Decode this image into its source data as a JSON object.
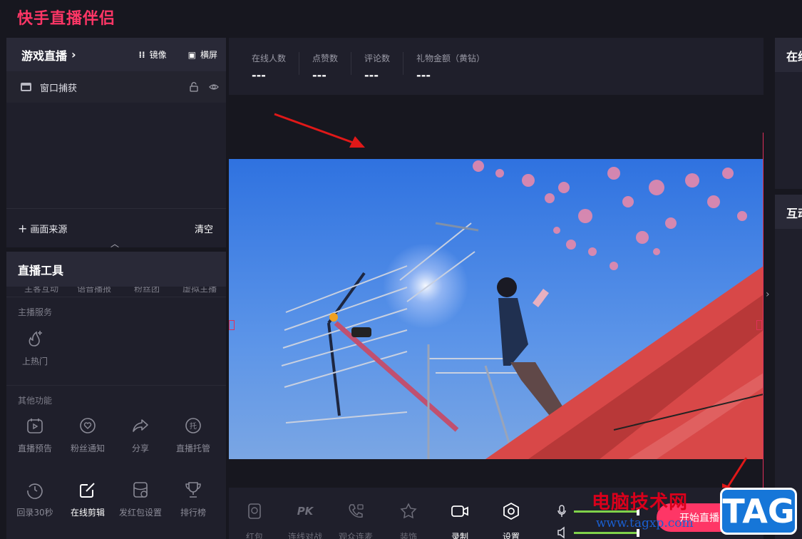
{
  "app": {
    "title": "快手直播伴侣"
  },
  "sources": {
    "title": "游戏直播",
    "mirror_label": "镜像",
    "landscape_label": "横屏",
    "items": [
      {
        "label": "窗口捕获"
      }
    ],
    "add_label": "画面来源",
    "clear_label": "清空"
  },
  "tools": {
    "title": "直播工具",
    "partial_row": [
      "主客互动",
      "语音播报",
      "粉丝团",
      "虚拟主播"
    ],
    "section_host": "主播服务",
    "host_items": [
      {
        "label": "上热门",
        "icon": "fire-plus-icon"
      }
    ],
    "section_other": "其他功能",
    "other_items": [
      {
        "label": "直播预告",
        "icon": "calendar-play-icon"
      },
      {
        "label": "粉丝通知",
        "icon": "heart-bubble-icon"
      },
      {
        "label": "分享",
        "icon": "share-arrow-icon"
      },
      {
        "label": "直播托管",
        "icon": "managed-icon"
      }
    ],
    "more_items": [
      {
        "label": "回录30秒",
        "icon": "replay-icon"
      },
      {
        "label": "在线剪辑",
        "icon": "edit-icon"
      },
      {
        "label": "发红包设置",
        "icon": "redpacket-settings-icon"
      },
      {
        "label": "排行榜",
        "icon": "trophy-icon"
      }
    ]
  },
  "stats": [
    {
      "label": "在线人数",
      "value": "---"
    },
    {
      "label": "点赞数",
      "value": "---"
    },
    {
      "label": "评论数",
      "value": "---"
    },
    {
      "label": "礼物金额（黄钻）",
      "value": "---"
    }
  ],
  "bottom_bar": {
    "items": [
      {
        "label": "红包",
        "icon": "redpacket-icon"
      },
      {
        "label": "连线对战",
        "icon": "pk-icon"
      },
      {
        "label": "观众连麦",
        "icon": "phone-call-icon"
      },
      {
        "label": "装饰",
        "icon": "decorate-icon"
      },
      {
        "label": "录制",
        "icon": "camera-record-icon"
      },
      {
        "label": "设置",
        "icon": "settings-hex-icon"
      }
    ],
    "start_label": "开始直播",
    "mic_level": 1.0,
    "speaker_level": 1.0,
    "level_color": "#7fd14a"
  },
  "right": {
    "online_title": "在线",
    "interact_title": "互动"
  },
  "watermark": {
    "cn": "电脑技术网",
    "url": "www.tagxp.com",
    "tag": "TAG"
  },
  "colors": {
    "accent": "#fe3666",
    "panel": "#1f1f2b",
    "header": "#292937"
  }
}
